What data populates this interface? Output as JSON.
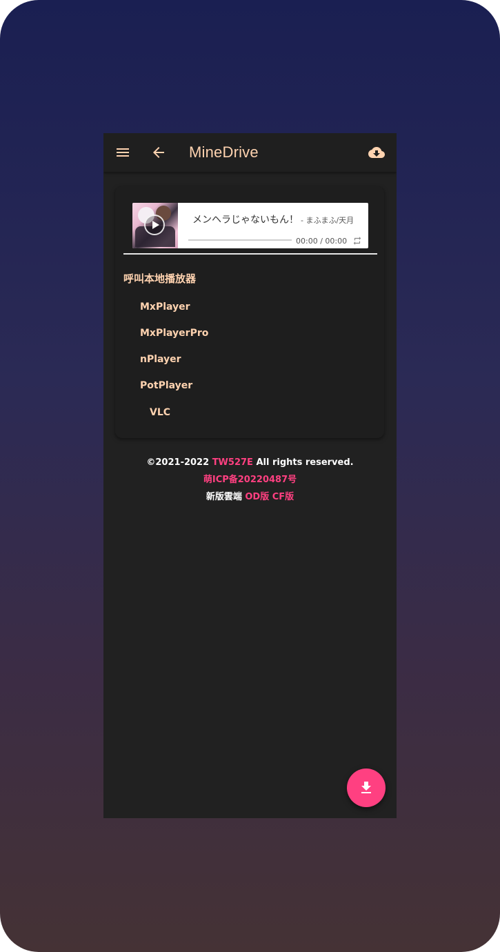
{
  "appbar": {
    "title": "MineDrive",
    "menu_icon": "menu-icon",
    "back_icon": "arrow-left-icon",
    "action_icon": "cloud-download-icon",
    "accent": "#ffd3b0"
  },
  "player": {
    "title": "メンヘラじゃないもん！",
    "artist": "- まふまふ/天月",
    "time": "00:00 / 00:00",
    "progress": 0,
    "play_icon": "play-icon",
    "loop_icon": "loop-icon"
  },
  "local_players": {
    "heading": "呼叫本地播放器",
    "items": [
      "MxPlayer",
      "MxPlayerPro",
      "nPlayer",
      "PotPlayer",
      "VLC"
    ]
  },
  "footer": {
    "copyright_prefix": "©2021-2022",
    "author": "TW527E",
    "copyright_suffix": "All rights reserved.",
    "icp": "萌ICP备20220487号",
    "new_version_label": "新版雲端",
    "od_link": "OD版",
    "cf_link": "CF版",
    "link_color": "#ff4081"
  },
  "fab": {
    "icon": "download-icon",
    "color": "#ff4081"
  }
}
